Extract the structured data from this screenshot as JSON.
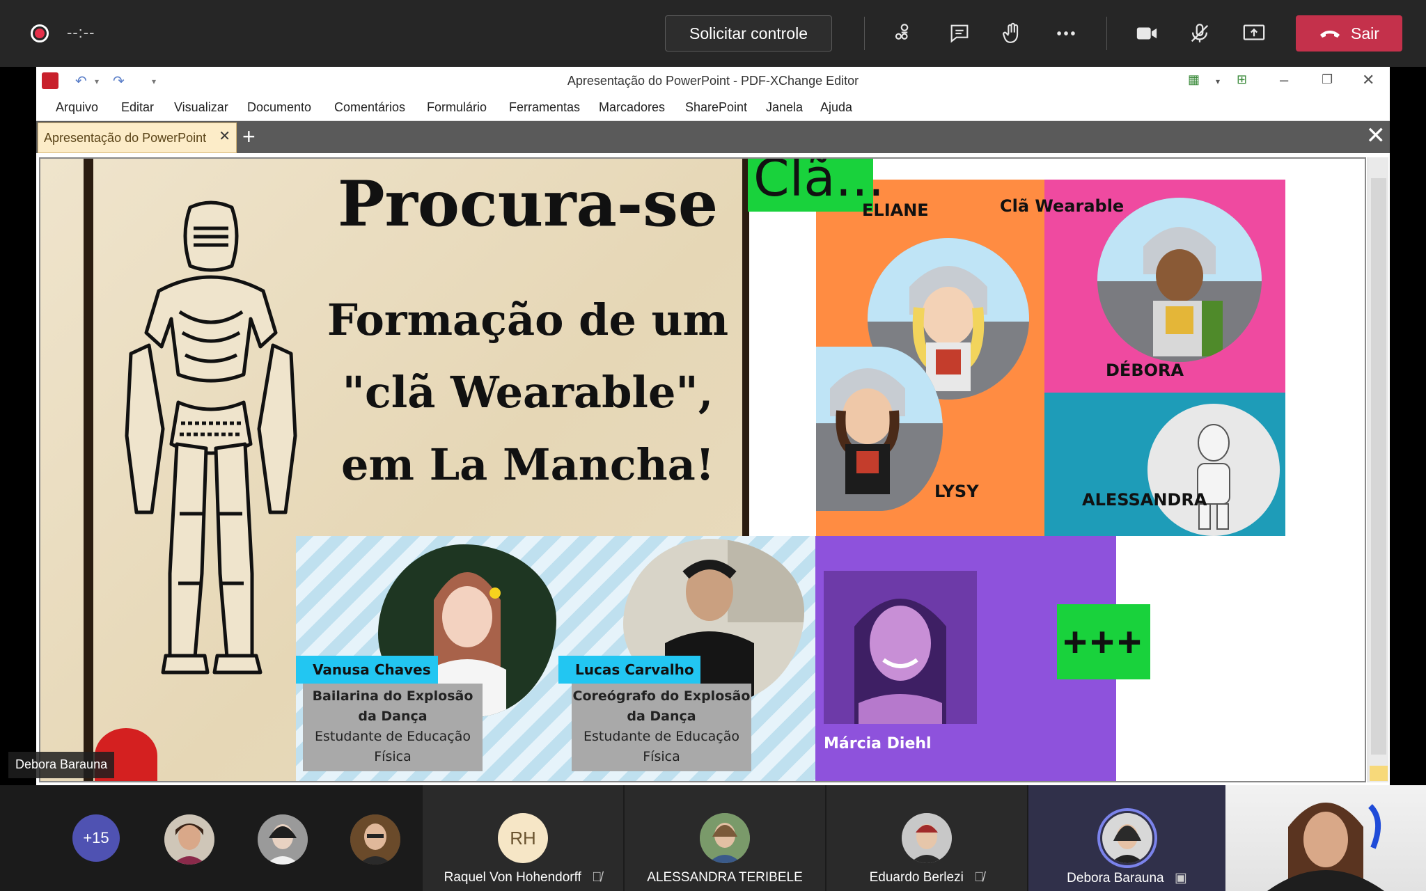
{
  "teams": {
    "timer": "--:--",
    "request_control_label": "Solicitar controle",
    "leave_label": "Sair"
  },
  "editor": {
    "window_title": "Apresentação do PowerPoint - PDF-XChange Editor",
    "menu": [
      "Arquivo",
      "Editar",
      "Visualizar",
      "Documento",
      "Comentários",
      "Formulário",
      "Ferramentas",
      "Marcadores",
      "SharePoint",
      "Janela",
      "Ajuda"
    ],
    "tab_label": "Apresentação do PowerPoint"
  },
  "slide": {
    "title": "Procura-se",
    "subtitle": "Formação de um\n\"clã Wearable\",\nem La Mancha!",
    "cla_badge": "Clã...",
    "avatar_labels": {
      "eliane": "ELIANE",
      "cla_wearable": "Clã Wearable",
      "debora": "DÉBORA",
      "lysy": "LYSY",
      "alessandra": "ALESSANDRA"
    },
    "people": [
      {
        "name": "Vanusa Chaves",
        "role_bold": "Bailarina do Explosão da Dança",
        "role_extra": "Estudante de Educação Física"
      },
      {
        "name": "Lucas Carvalho",
        "role_bold": "Coreógrafo do Explosão da Dança",
        "role_extra": "Estudante de Educação Física"
      }
    ],
    "marcia_name": "Márcia Diehl",
    "plus_badge": "+++"
  },
  "presenter_label": "Debora Barauna",
  "participants": {
    "more_count": "+15",
    "tiles": [
      {
        "name": "Raquel Von Hohendorff",
        "initials": "RH"
      },
      {
        "name": "ALESSANDRA TERIBELE"
      },
      {
        "name": "Eduardo Berlezi"
      },
      {
        "name": "Debora Barauna"
      }
    ]
  },
  "colors": {
    "leave_red": "#c4314b",
    "teams_purple": "#4f52b2",
    "cla_green": "#19d23c",
    "orange": "#ff8c42",
    "pink": "#ef4aa0",
    "teal": "#1e9cb8",
    "purple": "#8e52dc"
  }
}
